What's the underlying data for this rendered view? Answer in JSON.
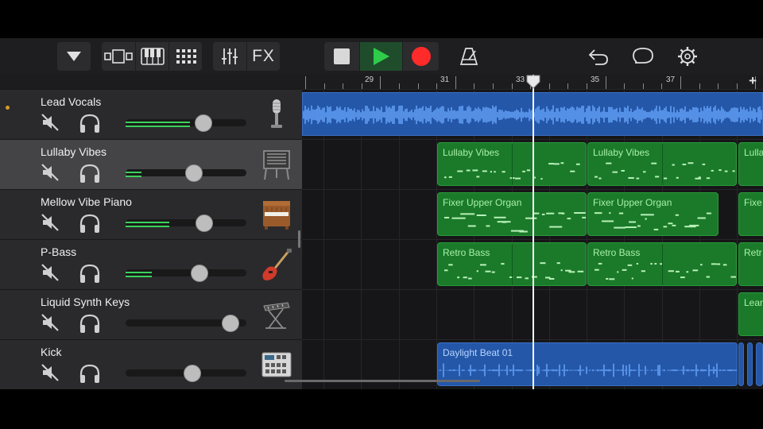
{
  "toolbar": {
    "browser_icon": "triangle-down-icon",
    "views": [
      "tracks-view-icon",
      "keyboard-icon",
      "grid-icon"
    ],
    "mixer_icon": "sliders-icon",
    "fx_label": "FX",
    "transport": [
      "stop-icon",
      "play-icon",
      "record-icon"
    ],
    "metronome_icon": "metronome-icon",
    "right_icons": [
      "undo-icon",
      "loop-icon",
      "settings-icon"
    ],
    "colors": {
      "play": "#2ecc4a",
      "record": "#ff2a2a"
    }
  },
  "ruler": {
    "bar_labels": [
      "29",
      "31",
      "33",
      "35",
      "37"
    ],
    "add_label": "+"
  },
  "tracks": [
    {
      "name": "Lead Vocals",
      "instrument": "microphone-icon",
      "volume": 0.67,
      "meter": 0.53,
      "selected": false
    },
    {
      "name": "Lullaby Vibes",
      "instrument": "vibraphone-icon",
      "volume": 0.58,
      "meter": 0.13,
      "selected": true
    },
    {
      "name": "Mellow Vibe Piano",
      "instrument": "upright-piano-icon",
      "volume": 0.68,
      "meter": 0.36,
      "selected": false
    },
    {
      "name": "P-Bass",
      "instrument": "bass-guitar-icon",
      "volume": 0.63,
      "meter": 0.22,
      "selected": false
    },
    {
      "name": "Liquid Synth Keys",
      "instrument": "synth-keyboard-icon",
      "volume": 0.93,
      "meter": 0,
      "selected": false
    },
    {
      "name": "Kick",
      "instrument": "drum-machine-icon",
      "volume": 0.56,
      "meter": 0,
      "selected": false
    }
  ],
  "regions": {
    "lullaby": "Lullaby Vibes",
    "organ": "Fixer Upper Organ",
    "bass": "Retro Bass",
    "beat": "Daylight Beat 01",
    "trunc_lullaby": "Lulla",
    "trunc_organ": "Fixe",
    "trunc_bass": "Retr",
    "trunc_synth": "Lean"
  }
}
